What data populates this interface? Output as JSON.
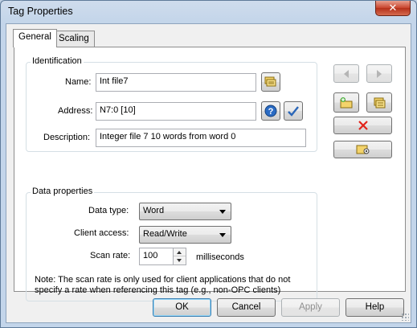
{
  "window": {
    "title": "Tag Properties",
    "close_glyph": "✕"
  },
  "tabs": [
    {
      "label": "General"
    },
    {
      "label": "Scaling"
    }
  ],
  "identification": {
    "legend": "Identification",
    "name_label": "Name:",
    "name_value": "Int file7",
    "address_label": "Address:",
    "address_value": "N7:0 [10]",
    "description_label": "Description:",
    "description_value": "Integer file 7 10 words from word 0"
  },
  "data_properties": {
    "legend": "Data properties",
    "data_type_label": "Data type:",
    "data_type_value": "Word",
    "client_access_label": "Client access:",
    "client_access_value": "Read/Write",
    "scan_rate_label": "Scan rate:",
    "scan_rate_value": "100",
    "scan_rate_unit": "milliseconds",
    "note": "Note: The scan rate is only used for client applications that do not specify a rate when referencing this tag (e.g., non-OPC clients)"
  },
  "side_toolbar": {
    "icons": [
      "previous-icon",
      "next-icon",
      "new-tag-icon",
      "new-group-icon",
      "delete-icon",
      "properties-icon"
    ],
    "delete_color": "#e2231a"
  },
  "buttons": {
    "ok": "OK",
    "cancel": "Cancel",
    "apply": "Apply",
    "help": "Help"
  },
  "colors": {
    "title_bar": "#c3d5ea",
    "close_button": "#c8432c",
    "default_button_border": "#3c7fb1"
  }
}
